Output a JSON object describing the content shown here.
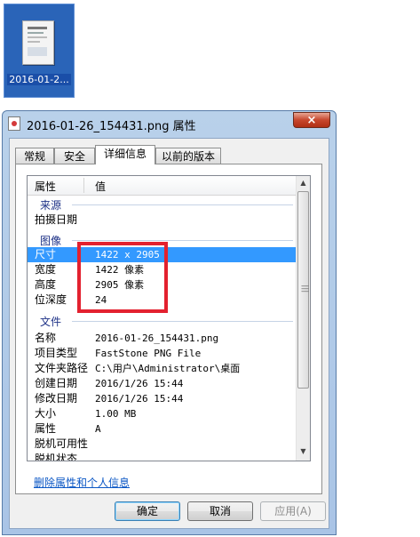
{
  "desktop": {
    "icon_label": "2016-01-2..."
  },
  "dialog": {
    "title": "2016-01-26_154431.png 属性",
    "close_glyph": "×",
    "tabs": [
      {
        "label": "常规",
        "active": false
      },
      {
        "label": "安全",
        "active": false
      },
      {
        "label": "详细信息",
        "active": true
      },
      {
        "label": "以前的版本",
        "active": false
      }
    ],
    "list": {
      "header": {
        "property": "属性",
        "value": "值"
      },
      "groups": {
        "origin": "来源",
        "image": "图像",
        "file": "文件"
      },
      "rows": {
        "date_taken": {
          "key": "拍摄日期",
          "value": ""
        },
        "dimensions": {
          "key": "尺寸",
          "value": "1422 x 2905",
          "selected": true
        },
        "width": {
          "key": "宽度",
          "value": "1422 像素"
        },
        "height": {
          "key": "高度",
          "value": "2905 像素"
        },
        "bit_depth": {
          "key": "位深度",
          "value": "24"
        },
        "name": {
          "key": "名称",
          "value": "2016-01-26_154431.png"
        },
        "item_type": {
          "key": "项目类型",
          "value": "FastStone PNG File"
        },
        "folder_path": {
          "key": "文件夹路径",
          "value": "C:\\用户\\Administrator\\桌面"
        },
        "created": {
          "key": "创建日期",
          "value": "2016/1/26 15:44"
        },
        "modified": {
          "key": "修改日期",
          "value": "2016/1/26 15:44"
        },
        "size": {
          "key": "大小",
          "value": "1.00 MB"
        },
        "attributes": {
          "key": "属性",
          "value": "A"
        },
        "offline": {
          "key": "脱机可用性",
          "value": ""
        },
        "offline_status": {
          "key": "脱机状态",
          "value": ""
        }
      }
    },
    "remove_link": "删除属性和个人信息",
    "buttons": {
      "ok": "确定",
      "cancel": "取消",
      "apply": "应用(A)"
    },
    "accent_colors": {
      "selection": "#3399ff",
      "group_text": "#1e3287",
      "highlight_box": "#e3212f"
    }
  }
}
